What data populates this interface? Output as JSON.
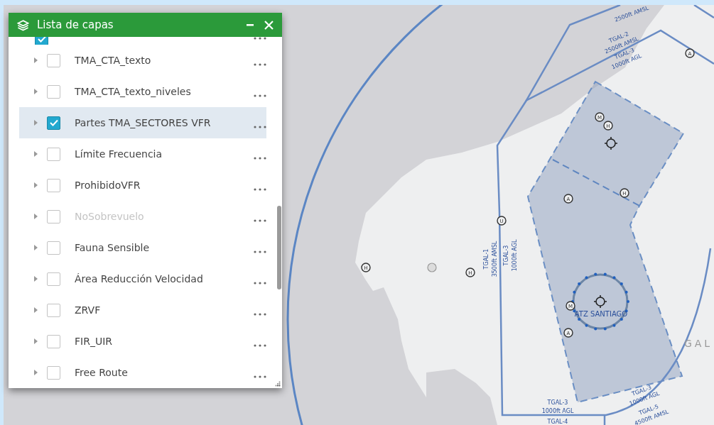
{
  "panel": {
    "title": "Lista de capas",
    "layers": [
      {
        "kind": "partial",
        "checked": true,
        "selected": false,
        "disabled": false
      },
      {
        "kind": "layer",
        "label": "TMA_CTA_texto",
        "checked": false,
        "selected": false,
        "disabled": false
      },
      {
        "kind": "layer",
        "label": "TMA_CTA_texto_niveles",
        "checked": false,
        "selected": false,
        "disabled": false
      },
      {
        "kind": "layer",
        "label": "Partes TMA_SECTORES VFR",
        "checked": true,
        "selected": true,
        "disabled": false
      },
      {
        "kind": "layer",
        "label": "Límite Frecuencia",
        "checked": false,
        "selected": false,
        "disabled": false
      },
      {
        "kind": "layer",
        "label": "ProhibidoVFR",
        "checked": false,
        "selected": false,
        "disabled": false
      },
      {
        "kind": "layer",
        "label": "NoSobrevuelo",
        "checked": false,
        "selected": false,
        "disabled": true
      },
      {
        "kind": "layer",
        "label": "Fauna Sensible",
        "checked": false,
        "selected": false,
        "disabled": false
      },
      {
        "kind": "layer",
        "label": "Área Reducción Velocidad",
        "checked": false,
        "selected": false,
        "disabled": false
      },
      {
        "kind": "layer",
        "label": "ZRVF",
        "checked": false,
        "selected": false,
        "disabled": false
      },
      {
        "kind": "layer",
        "label": "FIR_UIR",
        "checked": false,
        "selected": false,
        "disabled": false
      },
      {
        "kind": "layer",
        "label": "Free Route",
        "checked": false,
        "selected": false,
        "disabled": false
      }
    ]
  },
  "map_labels": [
    "2500ft AMSL",
    "TGAL-2",
    "2500ft AMSL",
    "TGAL-3",
    "1000ft AGL",
    "TGAL-1",
    "3500ft AMSL",
    "TGAL-3",
    "1000ft AGL",
    "ATZ SANTIAGO",
    "GAL",
    "TGAL-3",
    "1000ft AGL",
    "TGAL-4",
    "TGAL-3",
    "1000ft AGL",
    "TGAL-5",
    "4500ft AMSL"
  ],
  "map_markers": [
    {
      "kind": "letter",
      "letter": "A"
    },
    {
      "kind": "letter",
      "letter": "M"
    },
    {
      "kind": "letter",
      "letter": "H"
    },
    {
      "kind": "crosshair"
    },
    {
      "kind": "letter",
      "letter": "A"
    },
    {
      "kind": "letter",
      "letter": "H"
    },
    {
      "kind": "letter",
      "letter": "U"
    },
    {
      "kind": "letter",
      "letter": "H"
    },
    {
      "kind": "plain"
    },
    {
      "kind": "letter",
      "letter": "H"
    },
    {
      "kind": "letter",
      "letter": "M"
    },
    {
      "kind": "letter",
      "letter": "A"
    },
    {
      "kind": "crosshair"
    }
  ]
}
